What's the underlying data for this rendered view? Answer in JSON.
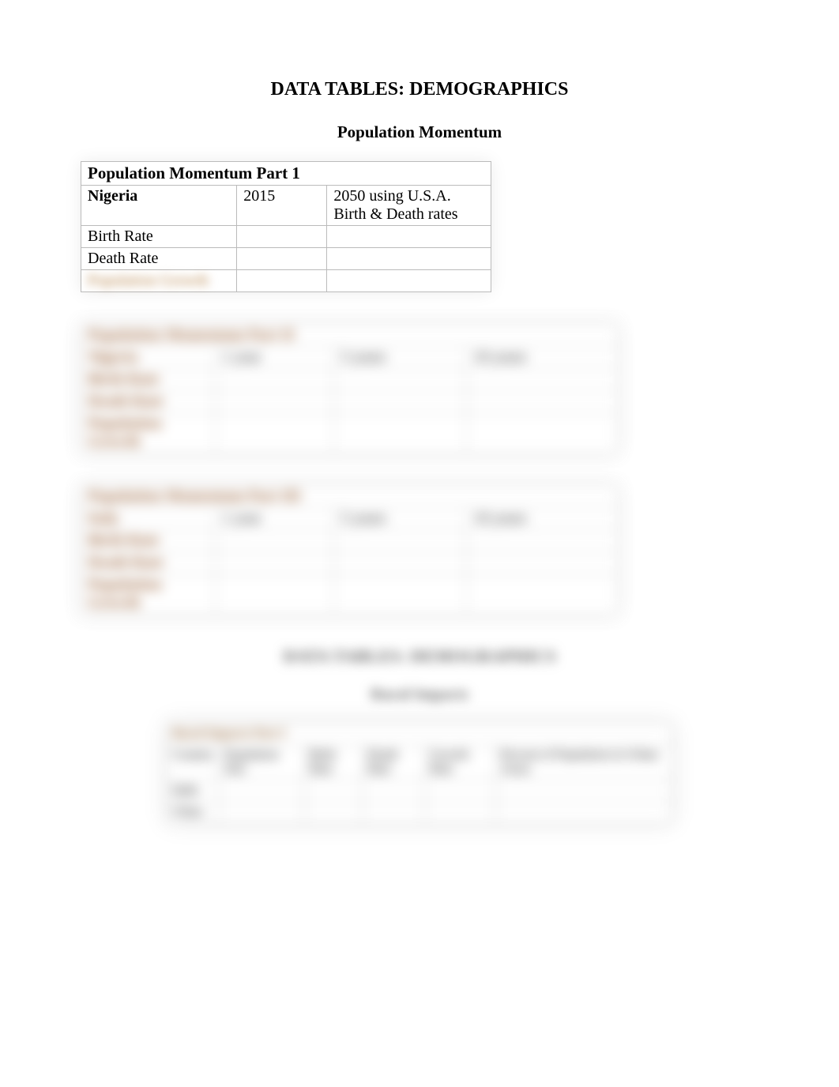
{
  "main_title": "DATA TABLES: DEMOGRAPHICS",
  "sub_title": "Population Momentum",
  "table1": {
    "title": "Population Momentum Part 1",
    "country_header": "Nigeria",
    "col_b_header": "2015",
    "col_c_header": "2050 using U.S.A. Birth & Death rates",
    "rows": [
      {
        "label": "Birth Rate",
        "col_b": "",
        "col_c": ""
      },
      {
        "label": "Death Rate",
        "col_b": "",
        "col_c": ""
      },
      {
        "label": "Population Growth",
        "col_b": "",
        "col_c": ""
      }
    ]
  },
  "table2a": {
    "title": "Population Momentum   Part II",
    "country": "Nigeria",
    "headers": [
      "1 year",
      "5 years",
      "10 years"
    ],
    "rows": [
      {
        "label": "Birth Rate"
      },
      {
        "label": "Death Rate"
      },
      {
        "label": "Population Growth"
      }
    ]
  },
  "table2b": {
    "title": "Population Momentum   Part III",
    "country": "Italy",
    "headers": [
      "1 year",
      "5 years",
      "10 years"
    ],
    "rows": [
      {
        "label": "Birth Rate"
      },
      {
        "label": "Death Rate"
      },
      {
        "label": "Population Growth"
      }
    ]
  },
  "section2": {
    "title": "DATA TABLES: DEMOGRAPHICS",
    "sub": "Rural Impacts",
    "table_title": "Rural Impacts   Part I",
    "cols": [
      "Country",
      "Population Size",
      "Birth Rate",
      "Death Rate",
      "Growth Rate",
      "Percent of Population in Urban Areas"
    ],
    "rows": [
      "India",
      "China"
    ]
  }
}
